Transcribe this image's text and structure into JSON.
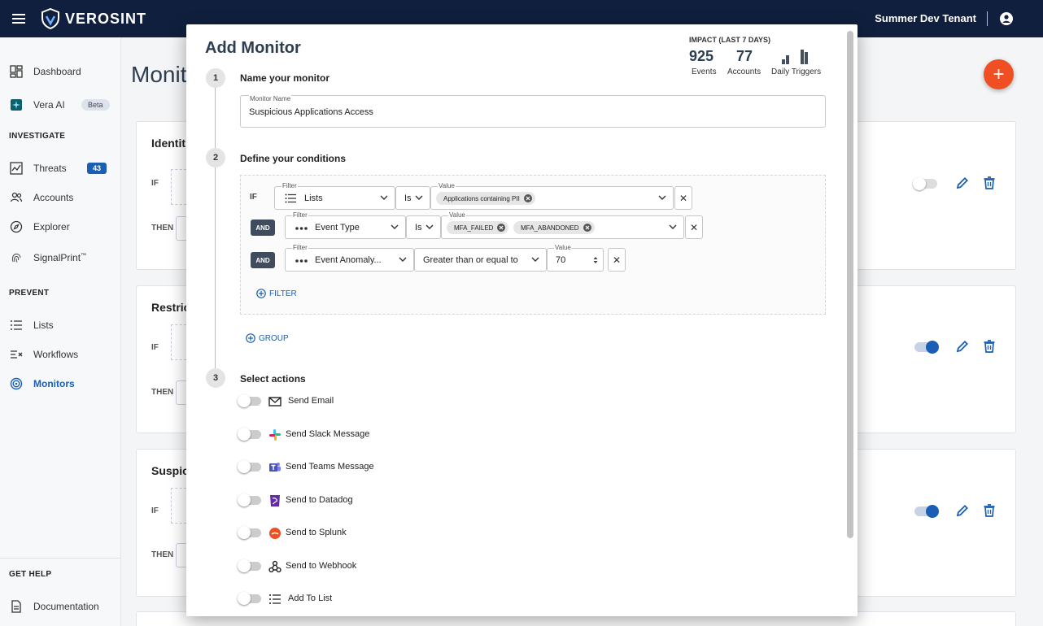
{
  "app": {
    "brand": "VEROSINT",
    "tenant": "Summer Dev Tenant"
  },
  "sidebar": {
    "top": [
      {
        "label": "Dashboard"
      },
      {
        "label": "Vera AI",
        "badge": "Beta"
      }
    ],
    "investigate": {
      "title": "INVESTIGATE",
      "items": [
        {
          "label": "Threats",
          "badge": "43"
        },
        {
          "label": "Accounts"
        },
        {
          "label": "Explorer"
        },
        {
          "label": "SignalPrint",
          "tm": "™"
        }
      ]
    },
    "prevent": {
      "title": "PREVENT",
      "items": [
        {
          "label": "Lists"
        },
        {
          "label": "Workflows"
        },
        {
          "label": "Monitors",
          "active": true
        }
      ]
    },
    "help": {
      "title": "GET HELP",
      "items": [
        {
          "label": "Documentation"
        }
      ]
    }
  },
  "background": {
    "page_title": "Monit",
    "cards": [
      {
        "title": "Identit",
        "if": "IF",
        "then": "THEN",
        "enabled": false
      },
      {
        "title": "Restric",
        "if": "IF",
        "then": "THEN",
        "enabled": true
      },
      {
        "title": "Suspici",
        "if": "IF",
        "then": "THEN",
        "enabled": true
      }
    ]
  },
  "modal": {
    "title": "Add Monitor",
    "impact": {
      "title": "IMPACT (LAST 7 DAYS)",
      "events_value": "925",
      "events_label": "Events",
      "accounts_value": "77",
      "accounts_label": "Accounts",
      "triggers_label": "Daily Triggers"
    },
    "steps": {
      "name": {
        "num": "1",
        "title": "Name your monitor",
        "field_label": "Monitor Name",
        "field_value": "Suspicious Applications Access"
      },
      "conditions": {
        "num": "2",
        "title": "Define your conditions",
        "if_label": "IF",
        "and_label": "AND",
        "filter_label": "Filter",
        "value_label": "Value",
        "rows": [
          {
            "filter": "Lists",
            "operator": "Is",
            "chips": [
              "Applications containing PII"
            ]
          },
          {
            "filter": "Event Type",
            "operator": "Is",
            "chips": [
              "MFA_FAILED",
              "MFA_ABANDONED"
            ]
          },
          {
            "filter": "Event Anomaly...",
            "operator": "Greater than or equal to",
            "value": "70"
          }
        ],
        "add_filter": "FILTER",
        "add_group": "GROUP"
      },
      "actions": {
        "num": "3",
        "title": "Select actions",
        "items": [
          {
            "label": "Send Email",
            "icon": "mail-icon",
            "enabled": false
          },
          {
            "label": "Send Slack Message",
            "icon": "slack-icon",
            "enabled": false
          },
          {
            "label": "Send Teams Message",
            "icon": "teams-icon",
            "enabled": false
          },
          {
            "label": "Send to Datadog",
            "icon": "datadog-icon",
            "enabled": false
          },
          {
            "label": "Send to Splunk",
            "icon": "splunk-icon",
            "enabled": false
          },
          {
            "label": "Send to Webhook",
            "icon": "webhook-icon",
            "enabled": false
          },
          {
            "label": "Add To List",
            "icon": "list-icon",
            "enabled": false
          }
        ]
      }
    }
  },
  "colors": {
    "topbar": "#0f1f3d",
    "accent": "#1a5fb4",
    "fab": "#f04e23"
  }
}
